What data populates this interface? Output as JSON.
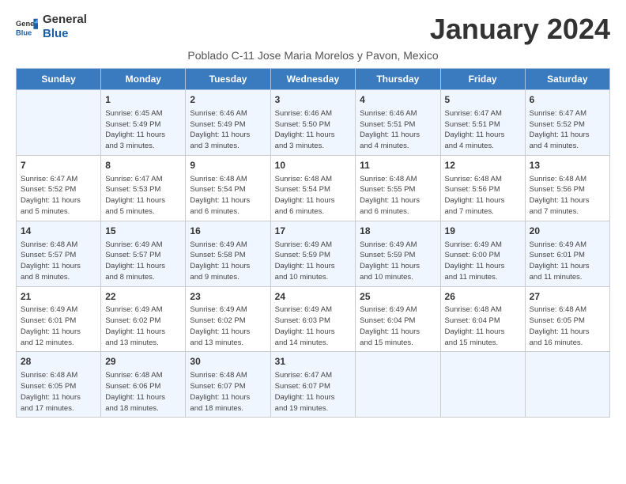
{
  "logo": {
    "general": "General",
    "blue": "Blue"
  },
  "title": "January 2024",
  "subtitle": "Poblado C-11 Jose Maria Morelos y Pavon, Mexico",
  "weekdays": [
    "Sunday",
    "Monday",
    "Tuesday",
    "Wednesday",
    "Thursday",
    "Friday",
    "Saturday"
  ],
  "weeks": [
    [
      {
        "day": null,
        "info": null
      },
      {
        "day": "1",
        "info": "Sunrise: 6:45 AM\nSunset: 5:49 PM\nDaylight: 11 hours\nand 3 minutes."
      },
      {
        "day": "2",
        "info": "Sunrise: 6:46 AM\nSunset: 5:49 PM\nDaylight: 11 hours\nand 3 minutes."
      },
      {
        "day": "3",
        "info": "Sunrise: 6:46 AM\nSunset: 5:50 PM\nDaylight: 11 hours\nand 3 minutes."
      },
      {
        "day": "4",
        "info": "Sunrise: 6:46 AM\nSunset: 5:51 PM\nDaylight: 11 hours\nand 4 minutes."
      },
      {
        "day": "5",
        "info": "Sunrise: 6:47 AM\nSunset: 5:51 PM\nDaylight: 11 hours\nand 4 minutes."
      },
      {
        "day": "6",
        "info": "Sunrise: 6:47 AM\nSunset: 5:52 PM\nDaylight: 11 hours\nand 4 minutes."
      }
    ],
    [
      {
        "day": "7",
        "info": "Sunrise: 6:47 AM\nSunset: 5:52 PM\nDaylight: 11 hours\nand 5 minutes."
      },
      {
        "day": "8",
        "info": "Sunrise: 6:47 AM\nSunset: 5:53 PM\nDaylight: 11 hours\nand 5 minutes."
      },
      {
        "day": "9",
        "info": "Sunrise: 6:48 AM\nSunset: 5:54 PM\nDaylight: 11 hours\nand 6 minutes."
      },
      {
        "day": "10",
        "info": "Sunrise: 6:48 AM\nSunset: 5:54 PM\nDaylight: 11 hours\nand 6 minutes."
      },
      {
        "day": "11",
        "info": "Sunrise: 6:48 AM\nSunset: 5:55 PM\nDaylight: 11 hours\nand 6 minutes."
      },
      {
        "day": "12",
        "info": "Sunrise: 6:48 AM\nSunset: 5:56 PM\nDaylight: 11 hours\nand 7 minutes."
      },
      {
        "day": "13",
        "info": "Sunrise: 6:48 AM\nSunset: 5:56 PM\nDaylight: 11 hours\nand 7 minutes."
      }
    ],
    [
      {
        "day": "14",
        "info": "Sunrise: 6:48 AM\nSunset: 5:57 PM\nDaylight: 11 hours\nand 8 minutes."
      },
      {
        "day": "15",
        "info": "Sunrise: 6:49 AM\nSunset: 5:57 PM\nDaylight: 11 hours\nand 8 minutes."
      },
      {
        "day": "16",
        "info": "Sunrise: 6:49 AM\nSunset: 5:58 PM\nDaylight: 11 hours\nand 9 minutes."
      },
      {
        "day": "17",
        "info": "Sunrise: 6:49 AM\nSunset: 5:59 PM\nDaylight: 11 hours\nand 10 minutes."
      },
      {
        "day": "18",
        "info": "Sunrise: 6:49 AM\nSunset: 5:59 PM\nDaylight: 11 hours\nand 10 minutes."
      },
      {
        "day": "19",
        "info": "Sunrise: 6:49 AM\nSunset: 6:00 PM\nDaylight: 11 hours\nand 11 minutes."
      },
      {
        "day": "20",
        "info": "Sunrise: 6:49 AM\nSunset: 6:01 PM\nDaylight: 11 hours\nand 11 minutes."
      }
    ],
    [
      {
        "day": "21",
        "info": "Sunrise: 6:49 AM\nSunset: 6:01 PM\nDaylight: 11 hours\nand 12 minutes."
      },
      {
        "day": "22",
        "info": "Sunrise: 6:49 AM\nSunset: 6:02 PM\nDaylight: 11 hours\nand 13 minutes."
      },
      {
        "day": "23",
        "info": "Sunrise: 6:49 AM\nSunset: 6:02 PM\nDaylight: 11 hours\nand 13 minutes."
      },
      {
        "day": "24",
        "info": "Sunrise: 6:49 AM\nSunset: 6:03 PM\nDaylight: 11 hours\nand 14 minutes."
      },
      {
        "day": "25",
        "info": "Sunrise: 6:49 AM\nSunset: 6:04 PM\nDaylight: 11 hours\nand 15 minutes."
      },
      {
        "day": "26",
        "info": "Sunrise: 6:48 AM\nSunset: 6:04 PM\nDaylight: 11 hours\nand 15 minutes."
      },
      {
        "day": "27",
        "info": "Sunrise: 6:48 AM\nSunset: 6:05 PM\nDaylight: 11 hours\nand 16 minutes."
      }
    ],
    [
      {
        "day": "28",
        "info": "Sunrise: 6:48 AM\nSunset: 6:05 PM\nDaylight: 11 hours\nand 17 minutes."
      },
      {
        "day": "29",
        "info": "Sunrise: 6:48 AM\nSunset: 6:06 PM\nDaylight: 11 hours\nand 18 minutes."
      },
      {
        "day": "30",
        "info": "Sunrise: 6:48 AM\nSunset: 6:07 PM\nDaylight: 11 hours\nand 18 minutes."
      },
      {
        "day": "31",
        "info": "Sunrise: 6:47 AM\nSunset: 6:07 PM\nDaylight: 11 hours\nand 19 minutes."
      },
      {
        "day": null,
        "info": null
      },
      {
        "day": null,
        "info": null
      },
      {
        "day": null,
        "info": null
      }
    ]
  ]
}
